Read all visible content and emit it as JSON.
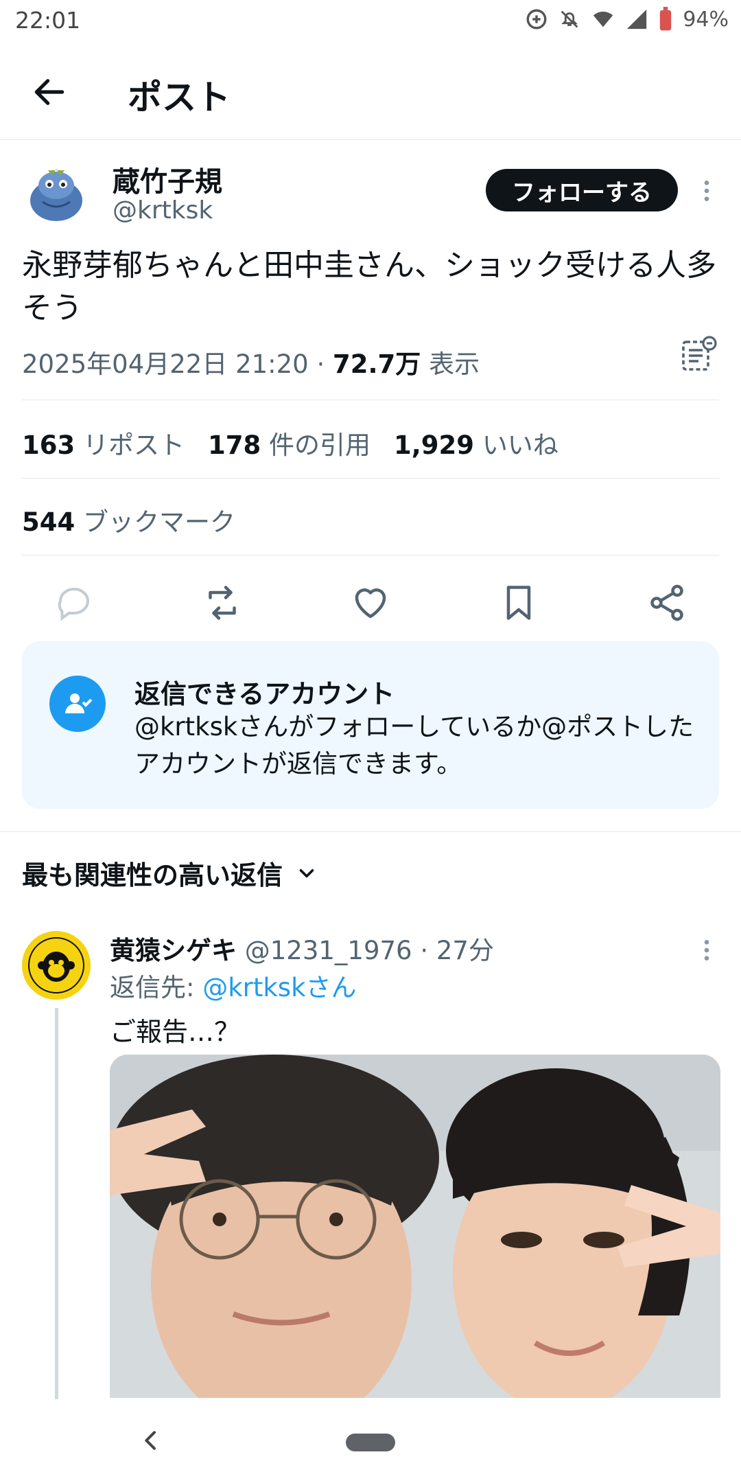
{
  "status_bar": {
    "time": "22:01",
    "battery": "94%"
  },
  "header": {
    "title": "ポスト"
  },
  "author": {
    "name": "蔵竹子規",
    "handle": "@krtksk",
    "follow_label": "フォローする"
  },
  "post": {
    "text": "永野芽郁ちゃんと田中圭さん、ショック受ける人多そう",
    "date": "2025年04月22日 21:20",
    "separator": " · ",
    "views": "72.7万",
    "views_label": "表示"
  },
  "stats": {
    "reposts": "163",
    "reposts_label": "リポスト",
    "quotes": "178",
    "quotes_label": "件の引用",
    "likes": "1,929",
    "likes_label": "いいね",
    "bookmarks": "544",
    "bookmarks_label": "ブックマーク"
  },
  "notice": {
    "title": "返信できるアカウント",
    "body": "@krtkskさんがフォローしているか@ポストしたアカウントが返信できます。"
  },
  "replies_sort": {
    "label": "最も関連性の高い返信"
  },
  "reply": {
    "name": "黄猿シゲキ",
    "handle": "@1231_1976",
    "time": "27分",
    "to_prefix": "返信先:",
    "to_handle": "@krtkskさん",
    "text": "ご報告…？"
  },
  "icons": {
    "back": "arrow-left-icon",
    "more": "more-vertical-icon",
    "reply": "reply-icon",
    "repost": "repost-icon",
    "like": "heart-icon",
    "bookmark": "bookmark-icon",
    "share": "share-icon"
  },
  "colors": {
    "accent": "#1d9bf0",
    "notice_bg": "#eef8fe",
    "text": "#0f1419",
    "muted": "#536471"
  }
}
